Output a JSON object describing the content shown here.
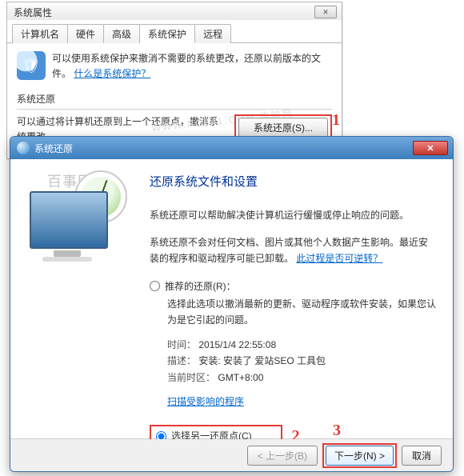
{
  "props": {
    "title": "系统属性",
    "close_glyph": "✕",
    "tabs": {
      "t0": "计算机名",
      "t1": "硬件",
      "t2": "高级",
      "t3": "系统保护",
      "t4": "远程"
    },
    "protect": {
      "shield_glyph": "🛡",
      "desc": "可以使用系统保护来撤消不需要的系统更改，还原以前版本的文件。",
      "link": "什么是系统保护？"
    },
    "restore_group": {
      "label": "系统还原",
      "desc": "可以通过将计算机还原到上一个还原点，撤消系统更改。",
      "button": "系统还原(S)..."
    },
    "annot1": "1"
  },
  "wizard": {
    "title": "系统还原",
    "close_glyph": "✕",
    "heading": "还原系统文件和设置",
    "p1": "系统还原可以帮助解决使计算机运行缓慢或停止响应的问题。",
    "p2a": "系统还原不会对任何文档、图片或其他个人数据产生影响。最近安装的程序和驱动程序可能已卸载。",
    "p2_link": "此过程是否可逆转？",
    "opt_rec": "推荐的还原(R)：",
    "opt_rec_desc": "选择此选项以撤消最新的更新、驱动程序或软件安装，如果您认为是它引起的问题。",
    "time_label": "时间：",
    "time_value": "2015/1/4 22:55:08",
    "desc_label": "描述：",
    "desc_value": "安装: 安装了 爱站SEO 工具包",
    "tz_label": "当前时区：",
    "tz_value": "GMT+8:00",
    "scan_link": "扫描受影响的程序",
    "opt_other": "选择另一还原点(C)",
    "annot2": "2",
    "annot3": "3",
    "btn_back": "< 上一步(B)",
    "btn_next": "下一步(N) >",
    "btn_cancel": "取消",
    "watermark1": "百事网",
    "watermark2": "WWW.PC841.COM 电脑网"
  }
}
